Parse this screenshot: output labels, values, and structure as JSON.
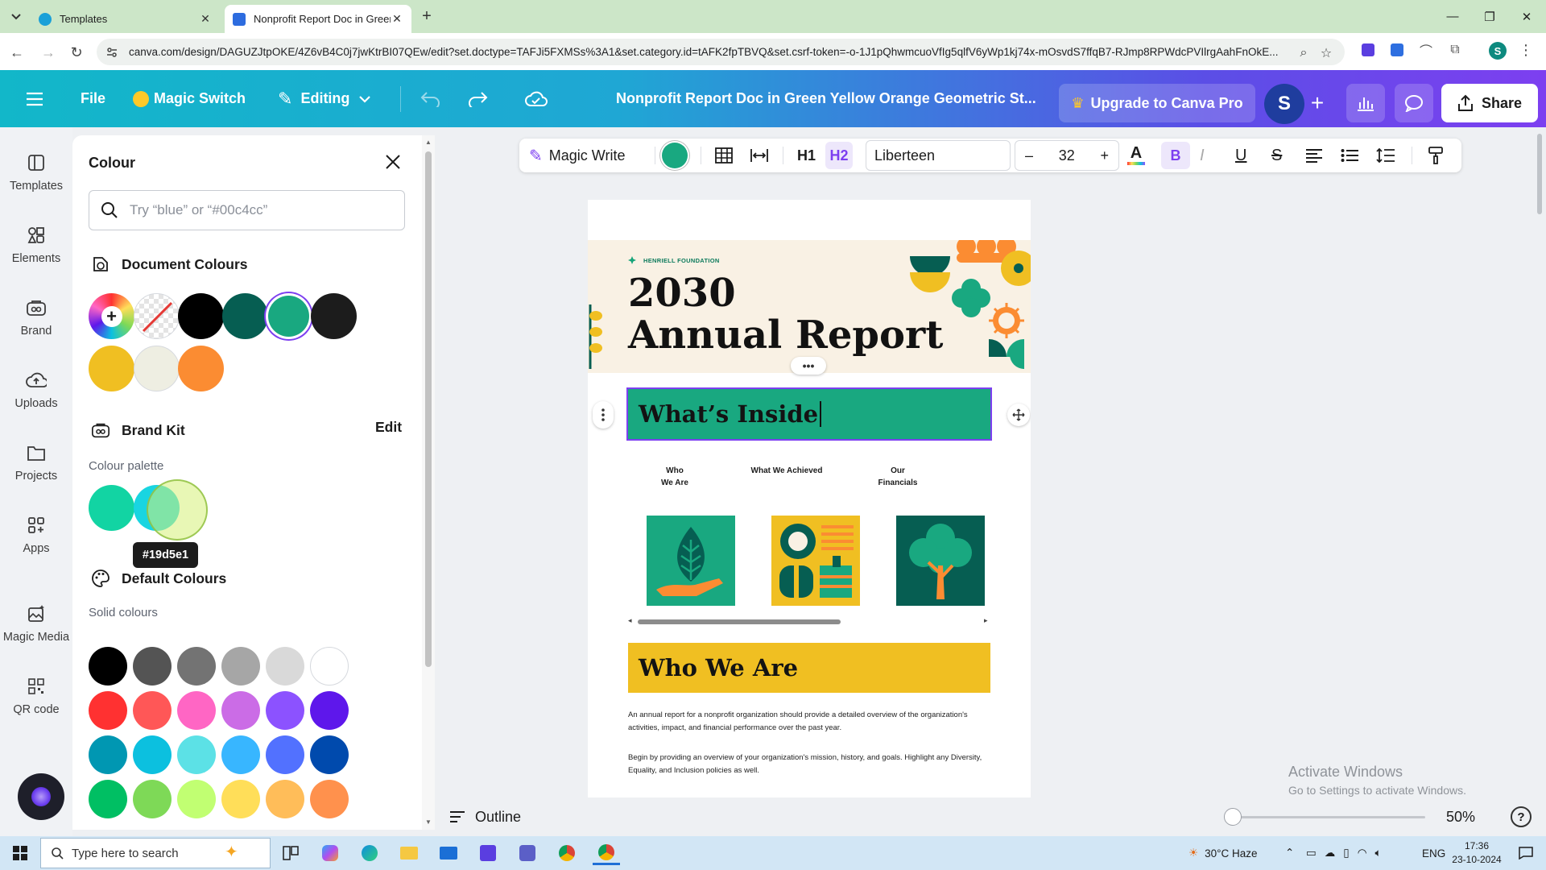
{
  "browser": {
    "tabs": [
      {
        "title": "Templates",
        "favicon_color": "#1aa0d8"
      },
      {
        "title": "Nonprofit Report Doc in Green",
        "favicon_color": "#2d6cdf"
      }
    ],
    "url": "canva.com/design/DAGUZJtpOKE/4Z6vB4C0j7jwKtrBI07QEw/edit?set.doctype=TAFJi5FXMSs%3A1&set.category.id=tAFK2fpTBVQ&set.csrf-token=-o-1J1pQhwmcuoVfIg5qlfV6yWp1kj74x-mOsvdS7ffqB7-RJmp8RPWdcPVIlrgAahFnOkE...",
    "profile_initial": "S"
  },
  "canva_header": {
    "file": "File",
    "magic_switch": "Magic Switch",
    "editing": "Editing",
    "doc_title": "Nonprofit Report Doc in Green Yellow Orange Geometric St...",
    "upgrade": "Upgrade to Canva Pro",
    "avatar_initial": "S",
    "share": "Share"
  },
  "rail": {
    "items": [
      "Templates",
      "Elements",
      "Brand",
      "Uploads",
      "Projects",
      "Apps",
      "Magic Media",
      "QR code"
    ]
  },
  "colour_panel": {
    "title": "Colour",
    "search_placeholder": "Try “blue” or “#00c4cc”",
    "document_colours_title": "Document Colours",
    "document_colours": [
      "#000000",
      "#065e52",
      "#19a880",
      "#1c1c1c",
      "#f0bf22",
      "#eeeee2",
      "#fb8c32"
    ],
    "brand_kit_title": "Brand Kit",
    "brand_kit_edit": "Edit",
    "colour_palette_label": "Colour palette",
    "brand_palette": [
      "#12d4a3",
      "#19d5e1"
    ],
    "tooltip": "#19d5e1",
    "default_colours_title": "Default Colours",
    "solid_colours_label": "Solid colours",
    "solid_colours": [
      "#000000",
      "#545454",
      "#737373",
      "#a6a6a6",
      "#d9d9d9",
      "#ffffff",
      "#ff3131",
      "#ff5757",
      "#ff66c4",
      "#cb6ce6",
      "#8c52ff",
      "#5e17eb",
      "#0097b2",
      "#0cc0df",
      "#5ce1e6",
      "#38b6ff",
      "#5271ff",
      "#004aad",
      "#00bf63",
      "#7ed957",
      "#c1ff72",
      "#ffde59",
      "#ffbd59",
      "#ff914d"
    ]
  },
  "toolbar": {
    "magic_write": "Magic Write",
    "text_color": "#19a880",
    "h1": "H1",
    "h2": "H2",
    "font": "Liberteen",
    "font_size": "32",
    "minus": "–",
    "plus": "+"
  },
  "document": {
    "foundation": "HENRIELL FOUNDATION",
    "title_line1": "2030",
    "title_line2": "Annual Report",
    "whats_inside": "What’s Inside",
    "columns": [
      {
        "label_line1": "Who",
        "label_line2": "We Are"
      },
      {
        "label_line1": "What We Achieved",
        "label_line2": ""
      },
      {
        "label_line1": "Our",
        "label_line2": "Financials"
      }
    ],
    "who_we_are": "Who We Are",
    "para1": "An annual report for a nonprofit organization should provide a detailed overview of the organization's activities, impact, and financial performance over the past year.",
    "para2": "Begin by providing an overview of your organization's mission, history, and goals. Highlight any Diversity, Equality, and Inclusion policies as well.",
    "colors": {
      "green": "#19a880",
      "dark_green": "#065e52",
      "yellow": "#f0bf22",
      "orange": "#fb8c32",
      "cream": "#f9f1e4"
    }
  },
  "bottom_bar": {
    "outline": "Outline",
    "zoom": "50%",
    "zoom_level_fraction": 0.02
  },
  "watermark": {
    "line1": "Activate Windows",
    "line2": "Go to Settings to activate Windows."
  },
  "taskbar": {
    "search_placeholder": "Type here to search",
    "weather": "30°C  Haze",
    "lang": "ENG",
    "time": "17:36",
    "date": "23-10-2024"
  }
}
